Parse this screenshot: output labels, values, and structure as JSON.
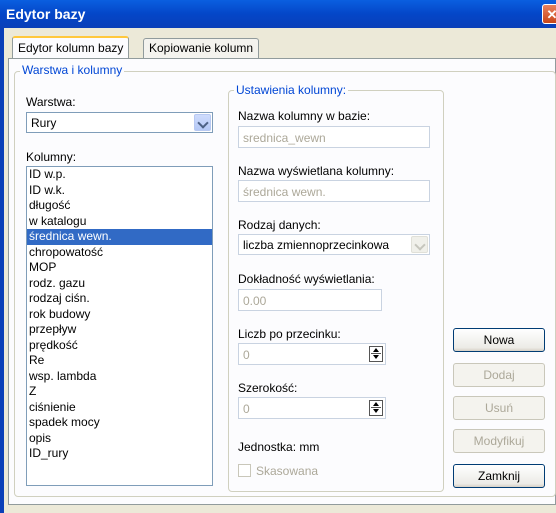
{
  "window": {
    "title": "Edytor bazy",
    "close_glyph": "✕"
  },
  "tabs": [
    {
      "label": "Edytor kolumn bazy",
      "active": true
    },
    {
      "label": "Kopiowanie kolumn",
      "active": false
    }
  ],
  "left_group": {
    "legend": "Warstwa i kolumny",
    "layer_label": "Warstwa:",
    "layer_value": "Rury",
    "columns_label": "Kolumny:",
    "columns": [
      "ID w.p.",
      "ID w.k.",
      "długość",
      "w katalogu",
      "średnica wewn.",
      "chropowatość",
      "MOP",
      "rodz. gazu",
      "rodzaj ciśn.",
      "rok budowy",
      "przepływ",
      "prędkość",
      "Re",
      "wsp. lambda",
      "Z",
      "ciśnienie",
      "spadek mocy",
      "opis",
      "ID_rury"
    ],
    "selected_index": 4
  },
  "settings": {
    "legend": "Ustawienia kolumny:",
    "db_name_label": "Nazwa kolumny w bazie:",
    "db_name_value": "srednica_wewn",
    "display_name_label": "Nazwa wyświetlana kolumny:",
    "display_name_value": "średnica wewn.",
    "data_type_label": "Rodzaj danych:",
    "data_type_value": "liczba zmiennoprzecinkowa",
    "precision_label": "Dokładność wyświetlania:",
    "precision_value": "0.00",
    "decimals_label": "Liczb po przecinku:",
    "decimals_value": "0",
    "width_label": "Szerokość:",
    "width_value": "0",
    "unit_text": "Jednostka: mm",
    "deleted_label": "Skasowana"
  },
  "buttons": {
    "new": "Nowa",
    "add": "Dodaj",
    "remove": "Usuń",
    "modify": "Modyfikuj",
    "close": "Zamknij"
  },
  "colors": {
    "titlebar": "#0446c8",
    "selection": "#316ac5",
    "legend": "#0046d5",
    "disabled_text": "#aca899"
  }
}
